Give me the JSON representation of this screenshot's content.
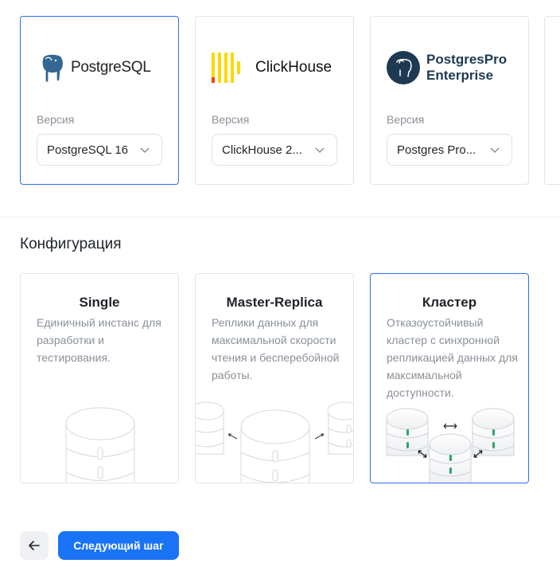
{
  "databases": [
    {
      "id": "postgresql",
      "logo_text": "PostgreSQL",
      "version_label": "Версия",
      "version_value": "PostgreSQL 16",
      "selected": true,
      "logo_icon": "elephant-icon"
    },
    {
      "id": "clickhouse",
      "logo_text": "ClickHouse",
      "version_label": "Версия",
      "version_value": "ClickHouse 2...",
      "selected": false,
      "logo_icon": "clickhouse-bars-icon"
    },
    {
      "id": "postgrespro",
      "logo_text_line1": "PostgresPro",
      "logo_text_line2": "Enterprise",
      "version_label": "Версия",
      "version_value": "Postgres Pro...",
      "selected": false,
      "logo_icon": "postgrespro-elephant-icon"
    }
  ],
  "configuration": {
    "title": "Конфигурация",
    "options": [
      {
        "id": "single",
        "title": "Single",
        "description": "Единичный инстанс для разработки и тестирования.",
        "selected": false,
        "illustration": "single-db-icon"
      },
      {
        "id": "master-replica",
        "title": "Master-Replica",
        "description": "Реплики данных для максимальной скорости чтения и бесперебойной работы.",
        "selected": false,
        "illustration": "master-replica-db-icon"
      },
      {
        "id": "cluster",
        "title": "Кластер",
        "description": "Отказоустойчивый кластер с синхронной репликацией данных для максимальной доступности.",
        "selected": true,
        "illustration": "cluster-db-icon"
      }
    ]
  },
  "footer": {
    "back_icon": "arrow-left-icon",
    "next_label": "Следующий шаг"
  },
  "colors": {
    "accent": "#2b6ef2",
    "button_primary": "#1a73f5",
    "clickhouse_yellow": "#fcd800",
    "clickhouse_red": "#ff3d00",
    "postgres_blue": "#336791",
    "postgrespro_navy": "#1d3a52"
  }
}
